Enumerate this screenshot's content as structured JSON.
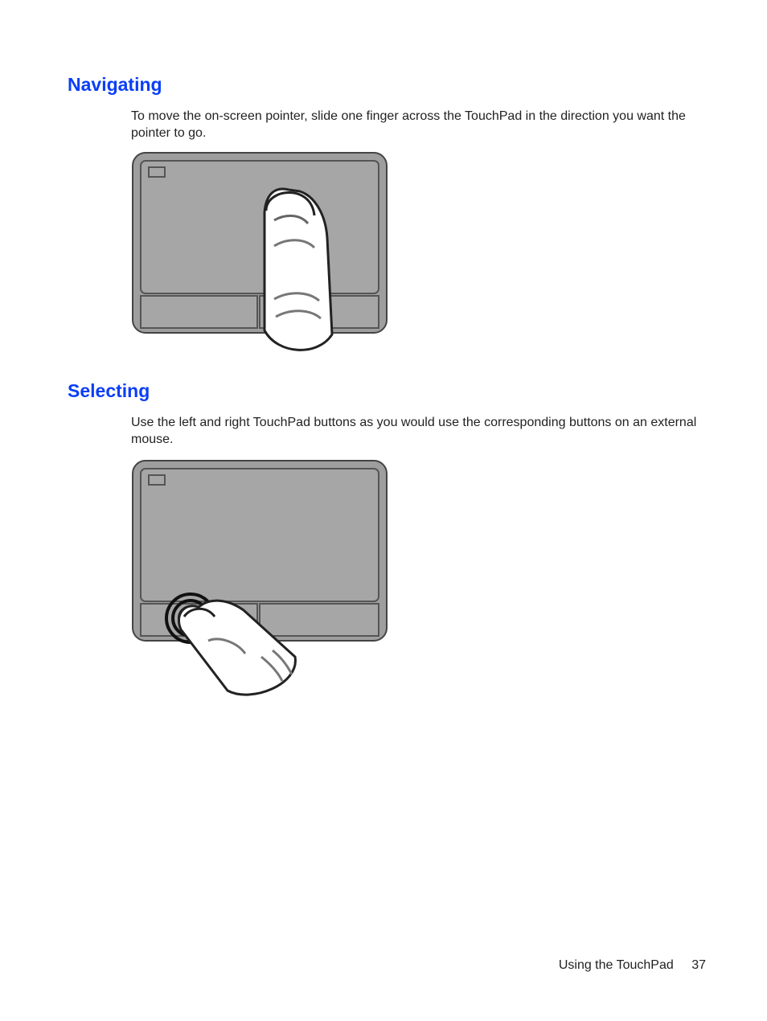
{
  "sections": {
    "navigating": {
      "heading": "Navigating",
      "body": "To move the on-screen pointer, slide one finger across the TouchPad in the direction you want the pointer to go."
    },
    "selecting": {
      "heading": "Selecting",
      "body": "Use the left and right TouchPad buttons as you would use the corresponding buttons on an external mouse."
    }
  },
  "footer": {
    "section_label": "Using the TouchPad",
    "page_number": "37"
  }
}
